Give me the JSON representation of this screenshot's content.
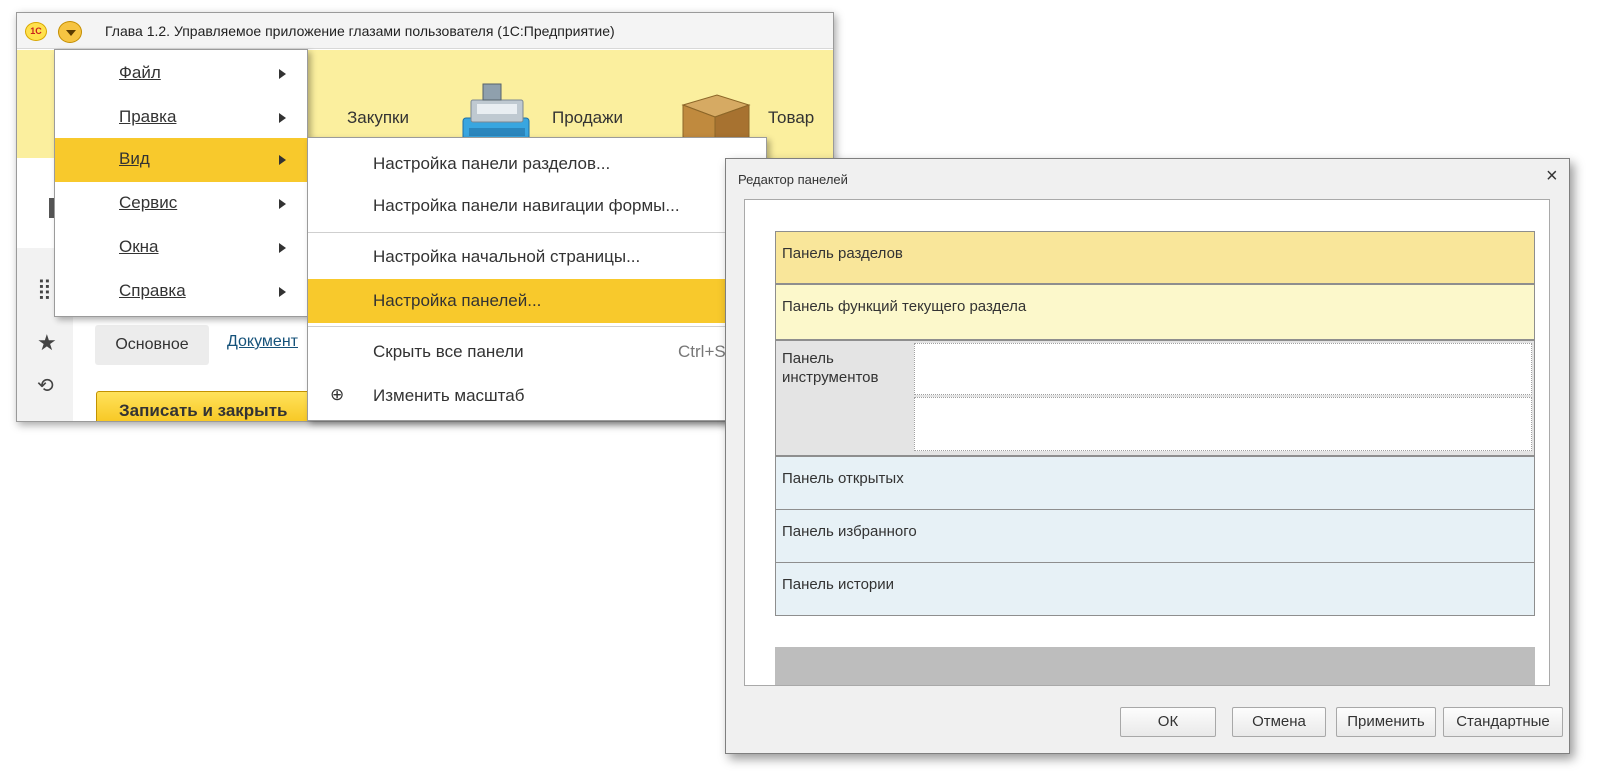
{
  "app_window": {
    "title": "Глава 1.2. Управляемое приложение глазами пользователя  (1С:Предприятие)",
    "logo_text": "1С",
    "sections": [
      "Закупки",
      "Продажи",
      "Товар"
    ],
    "form_tabs": {
      "main": "Основное",
      "documents": "Документ"
    },
    "save_close_label": "Записать и закрыть",
    "side_icons": [
      "apps-grid-icon",
      "star-icon",
      "history-icon"
    ]
  },
  "main_menu": {
    "items": [
      {
        "label": "Файл",
        "active": false
      },
      {
        "label": "Правка",
        "active": false
      },
      {
        "label": "Вид",
        "active": true
      },
      {
        "label": "Сервис",
        "active": false
      },
      {
        "label": "Окна",
        "active": false
      },
      {
        "label": "Справка",
        "active": false
      }
    ]
  },
  "view_submenu": {
    "items": [
      {
        "label": "Настройка панели разделов..."
      },
      {
        "label": "Настройка панели навигации формы..."
      },
      {
        "label": "Настройка начальной страницы..."
      },
      {
        "label": "Настройка панелей...",
        "active": true
      },
      {
        "label": "Скрыть все панели",
        "shortcut": "Ctrl+Sh"
      },
      {
        "label": "Изменить масштаб",
        "icon": "zoom-in-icon"
      }
    ]
  },
  "panel_editor": {
    "title": "Редактор панелей",
    "close_glyph": "×",
    "rows": [
      {
        "label": "Панель разделов"
      },
      {
        "label": "Панель функций текущего раздела"
      },
      {
        "label": "Панель инструментов"
      },
      {
        "label": "Панель открытых"
      },
      {
        "label": "Панель избранного"
      },
      {
        "label": "Панель истории"
      }
    ],
    "buttons": {
      "ok": "ОК",
      "cancel": "Отмена",
      "apply": "Применить",
      "default": "Стандартные"
    }
  },
  "colors": {
    "accent_yellow": "#f8c92c",
    "sections_bar": "#fbef9e",
    "row_sections": "#f9e69a",
    "row_functions": "#fcf8cb",
    "row_blue": "#e7f1f6",
    "row_tools": "#e4e4e4",
    "link_blue": "#15527a"
  }
}
